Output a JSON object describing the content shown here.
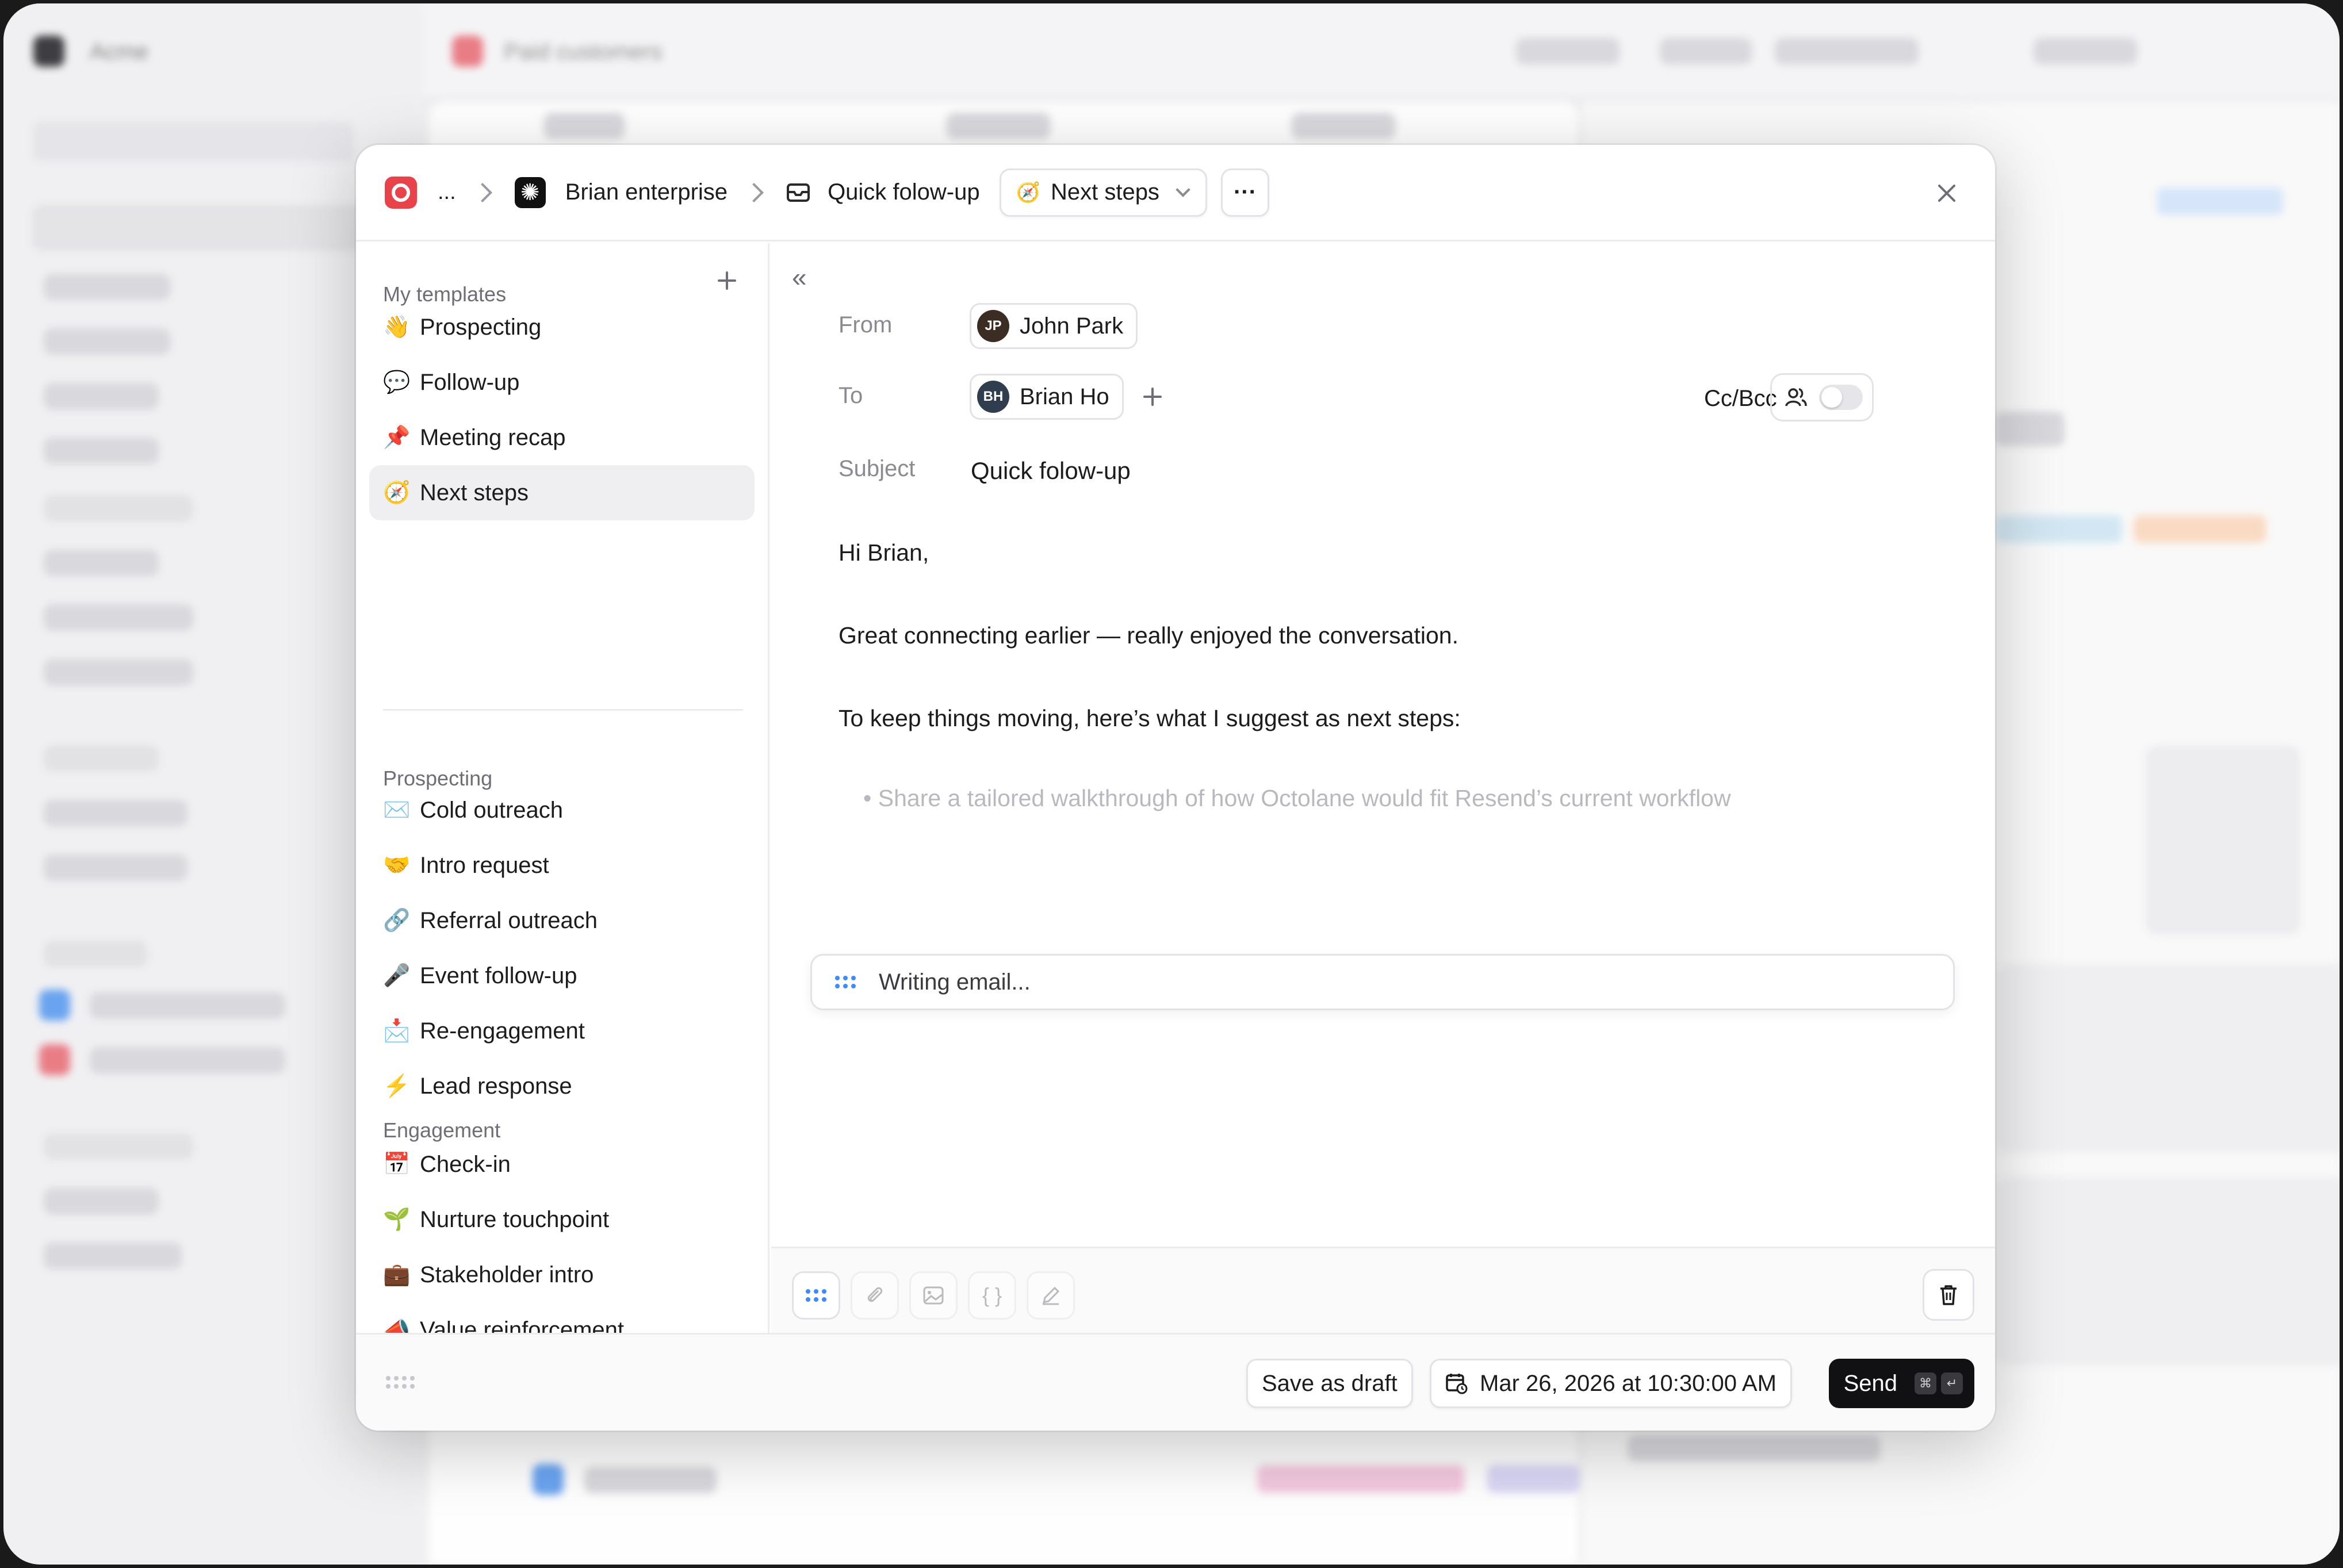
{
  "background": {
    "app_name": "Acme",
    "page_title": "Paid customers"
  },
  "header": {
    "breadcrumb_ellipsis": "...",
    "account": "Brian enterprise",
    "email_title": "Quick folow-up",
    "template_selector": "Next steps",
    "more_label": "···"
  },
  "sidebar": {
    "section_my_templates": "My templates",
    "my_templates": [
      {
        "emoji": "👋",
        "label": "Prospecting"
      },
      {
        "emoji": "💬",
        "label": "Follow-up"
      },
      {
        "emoji": "📌",
        "label": "Meeting recap"
      },
      {
        "emoji": "🧭",
        "label": "Next steps"
      }
    ],
    "section_prospecting": "Prospecting",
    "prospecting": [
      {
        "emoji": "✉️",
        "label": "Cold outreach"
      },
      {
        "emoji": "🤝",
        "label": "Intro request"
      },
      {
        "emoji": "🔗",
        "label": "Referral outreach"
      },
      {
        "emoji": "🎤",
        "label": "Event follow-up"
      },
      {
        "emoji": "📩",
        "label": "Re-engagement"
      },
      {
        "emoji": "⚡",
        "label": "Lead response"
      }
    ],
    "section_engagement": "Engagement",
    "engagement": [
      {
        "emoji": "📅",
        "label": "Check-in"
      },
      {
        "emoji": "🌱",
        "label": "Nurture touchpoint"
      },
      {
        "emoji": "💼",
        "label": "Stakeholder intro"
      },
      {
        "emoji": "📣",
        "label": "Value reinforcement"
      }
    ]
  },
  "email": {
    "from_label": "From",
    "from_name": "John Park",
    "to_label": "To",
    "to_name": "Brian Ho",
    "cc_label": "Cc/Bcc",
    "subject_label": "Subject",
    "subject_value": "Quick folow-up",
    "body": [
      "Hi Brian,",
      "Great connecting earlier — really enjoyed the conversation.",
      "To keep things moving, here’s what I suggest as next steps:"
    ],
    "bullet_faded": "Share a tailored walkthrough of how Octolane would fit Resend’s current workflow",
    "status": "Writing email..."
  },
  "footer": {
    "save_draft": "Save as draft",
    "schedule": "Mar 26, 2026 at 10:30:00 AM",
    "send": "Send",
    "kbd_cmd": "⌘",
    "kbd_enter": "↵"
  },
  "colors": {
    "brand": "#e8434b",
    "accent": "#3d8bfd",
    "send_bg": "#111113"
  }
}
